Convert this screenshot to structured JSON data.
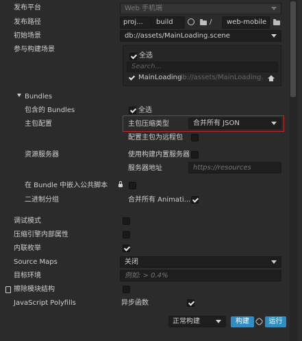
{
  "fields": {
    "platform_label": "发布平台",
    "platform_value": "Web 手机端",
    "path_label": "发布路径",
    "path_root": "proj...",
    "path_build": "build",
    "path_sep": "/",
    "path_name": "web-mobile",
    "start_scene_label": "初始场景",
    "start_scene_value": "db://assets/MainLoading.scene",
    "scenes_label": "参与构建场景",
    "select_all": "全选",
    "search_placeholder": "Search...",
    "scene_item_name": "MainLoading",
    "scene_item_path": "db://assets/MainLoading.scene"
  },
  "bundles": {
    "title": "Bundles",
    "included_label": "包含的 Bundles",
    "select_all": "全选",
    "main_config_label": "主包配置",
    "compress_label": "主包压缩类型",
    "compress_value": "合并所有 JSON",
    "remote_label": "配置主包为远程包",
    "resource_server_label": "资源服务器",
    "builtin_server_label": "使用构建内置服务器",
    "server_addr_label": "服务器地址",
    "server_addr_placeholder": "https://resources",
    "embed_script_label": "在 Bundle 中嵌入公共脚本",
    "binary_group_label": "二进制分组",
    "binary_group_value": "合并所有 Animati..."
  },
  "options": {
    "debug_label": "调试模式",
    "mangle_label": "压缩引擎内部属性",
    "inline_enum_label": "内联枚举",
    "sourcemaps_label": "Source Maps",
    "sourcemaps_value": "关闭",
    "target_env_label": "目标环境",
    "target_env_placeholder": "例如: > 0.4%",
    "erase_module_label": "擦除模块结构",
    "polyfills_label": "JavaScript Polyfills",
    "async_label": "异步函数"
  },
  "footer": {
    "build_mode": "正常构建",
    "build_label": "构建",
    "run_label": "运行"
  },
  "colors": {
    "accent": "#2f8fc4",
    "highlight_border": "#c0272d",
    "background": "#2b2b2b",
    "input_bg": "#1e1e1e"
  }
}
